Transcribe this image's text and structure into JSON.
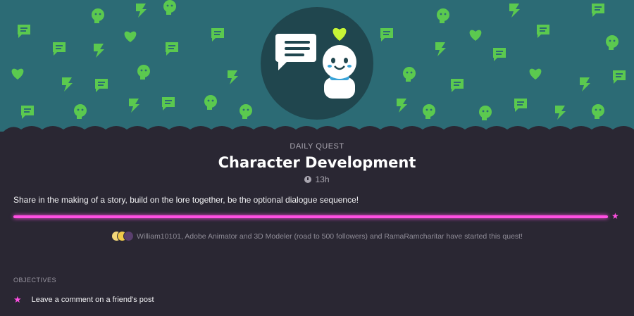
{
  "quest": {
    "eyebrow": "DAILY QUEST",
    "title": "Character Development",
    "time_left": "13h",
    "description": "Share in the making of a story, build on the lore together, be the optional dialogue sequence!",
    "progress": 1.0,
    "participants_text": "William10101, Adobe Animator and 3D Modeler (road to 500 followers) and RamaRamcharitar have started this quest!"
  },
  "objectives": {
    "header": "OBJECTIVES",
    "items": [
      {
        "label": "Leave a comment on a friend's post"
      }
    ]
  },
  "colors": {
    "banner": "#2c6b75",
    "emblem": "#20464e",
    "pattern": "#5bc94f",
    "background": "#2a2733",
    "accent": "#ff4fe3"
  },
  "icons": {
    "emblem_left": "speech-bubble-icon",
    "emblem_right": "snowman-character-icon",
    "heart": "heart-icon",
    "clock": "clock-icon",
    "star": "star-icon"
  }
}
